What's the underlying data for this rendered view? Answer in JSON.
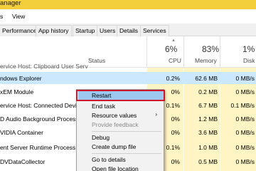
{
  "window": {
    "title": "anager"
  },
  "menu": {
    "items": [
      "s",
      "View"
    ]
  },
  "tabs": [
    "Performance",
    "App history",
    "Startup",
    "Users",
    "Details",
    "Services"
  ],
  "header": {
    "status_label": "Status",
    "cpu": {
      "pct": "6%",
      "label": "CPU"
    },
    "memory": {
      "pct": "83%",
      "label": "Memory"
    },
    "disk": {
      "pct": "1%",
      "label": "Disk"
    }
  },
  "rows": [
    {
      "name": "ervice Host: Clipboard User Serv",
      "cpu": "",
      "mem": "",
      "disk": ""
    },
    {
      "name": "ndows Explorer",
      "cpu": "0.2%",
      "mem": "62.6 MB",
      "disk": "0 MB/s"
    },
    {
      "name": "xEM Module",
      "cpu": "0%",
      "mem": "0.2 MB",
      "disk": "0 MB/s"
    },
    {
      "name": "ervice Host: Connected Device",
      "cpu": "0.1%",
      "mem": "6.7 MB",
      "disk": "0.1 MB/s"
    },
    {
      "name": "D Audio Background Process",
      "cpu": "0%",
      "mem": "1.2 MB",
      "disk": "0 MB/s"
    },
    {
      "name": "VIDIA Container",
      "cpu": "0%",
      "mem": "3.6 MB",
      "disk": "0 MB/s"
    },
    {
      "name": "ent Server Runtime Process",
      "cpu": "0.1%",
      "mem": "1.0 MB",
      "disk": "0 MB/s"
    },
    {
      "name": "DVDataCollector",
      "cpu": "0%",
      "mem": "0.5 MB",
      "disk": "0 MB/s"
    }
  ],
  "context_menu": {
    "restart": "Restart",
    "end_task": "End task",
    "resource_values": "Resource values",
    "provide_feedback": "Provide feedback",
    "debug": "Debug",
    "create_dump": "Create dump file",
    "go_to_details": "Go to details",
    "open_file_location": "Open file location",
    "submenu_arrow": "›"
  }
}
